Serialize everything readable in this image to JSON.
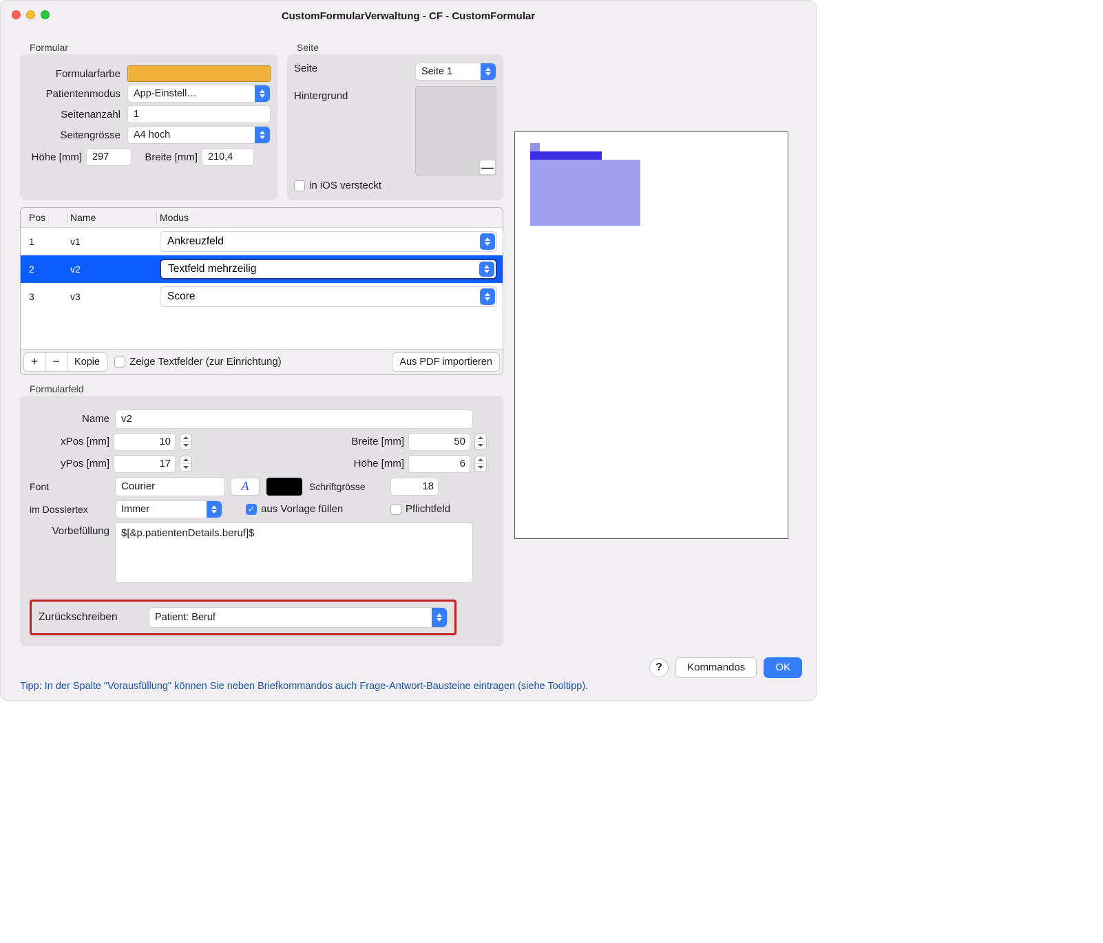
{
  "window": {
    "title": "CustomFormularVerwaltung - CF - CustomFormular"
  },
  "formular": {
    "legend": "Formular",
    "formularfarbe_label": "Formularfarbe",
    "formularfarbe_hex": "#f2b13c",
    "patientenmodus_label": "Patientenmodus",
    "patientenmodus_value": "App-Einstell…",
    "seitenanzahl_label": "Seitenanzahl",
    "seitenanzahl_value": "1",
    "seitengroesse_label": "Seitengrösse",
    "seitengroesse_value": "A4 hoch",
    "hoehe_label": "Höhe [mm]",
    "hoehe_value": "297",
    "breite_label": "Breite [mm]",
    "breite_value": "210,4"
  },
  "seite": {
    "legend": "Seite",
    "seite_label": "Seite",
    "seite_value": "Seite 1",
    "hintergrund_label": "Hintergrund",
    "in_ios_label": "in iOS versteckt",
    "in_ios_checked": false,
    "hint_minus": "—"
  },
  "table": {
    "col_pos": "Pos",
    "col_name": "Name",
    "col_modus": "Modus",
    "rows": [
      {
        "pos": "1",
        "name": "v1",
        "modus": "Ankreuzfeld",
        "selected": false
      },
      {
        "pos": "2",
        "name": "v2",
        "modus": "Textfeld mehrzeilig",
        "selected": true
      },
      {
        "pos": "3",
        "name": "v3",
        "modus": "Score",
        "selected": false
      }
    ],
    "toolbar": {
      "plus": "+",
      "minus": "−",
      "kopie": "Kopie",
      "zeige_label": "Zeige Textfelder (zur Einrichtung)",
      "zeige_checked": false,
      "import": "Aus PDF importieren"
    }
  },
  "feld": {
    "legend": "Formularfeld",
    "name_label": "Name",
    "name_value": "v2",
    "xpos_label": "xPos [mm]",
    "xpos_value": "10",
    "breite_label": "Breite [mm]",
    "breite_value": "50",
    "ypos_label": "yPos [mm]",
    "ypos_value": "17",
    "hoehe_label": "Höhe [mm]",
    "hoehe_value": "6",
    "font_label": "Font",
    "font_value": "Courier",
    "font_glyph": "A",
    "schriftgroesse_label": "Schriftgrösse",
    "schriftgroesse_value": "18",
    "dossier_label": "im Dossiertex",
    "dossier_value": "Immer",
    "aus_vorlage_label": "aus Vorlage füllen",
    "aus_vorlage_checked": true,
    "pflicht_label": "Pflichtfeld",
    "pflicht_checked": false,
    "vorbef_label": "Vorbefüllung",
    "vorbef_value": "$[&p.patientenDetails.beruf]$",
    "zuruck_label": "Zurückschreiben",
    "zuruck_value": "Patient: Beruf"
  },
  "footer": {
    "help": "?",
    "kommandos": "Kommandos",
    "ok": "OK"
  },
  "tipp": "Tipp: In der Spalte \"Vorausfüllung\" können Sie neben Briefkommandos auch Frage-Antwort-Bausteine eintragen (siehe Tooltipp).",
  "icons": {
    "close": "close-icon",
    "minimize": "minimize-icon",
    "zoom": "zoom-icon"
  }
}
